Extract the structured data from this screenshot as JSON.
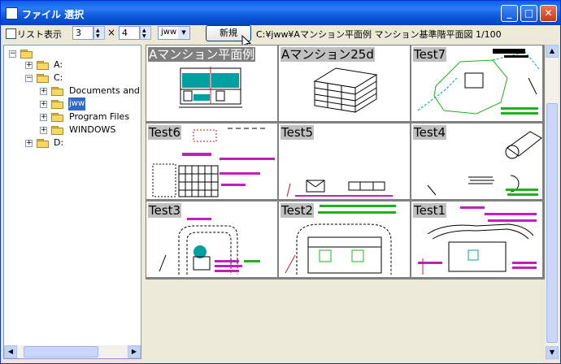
{
  "window": {
    "title": "ファイル 選択"
  },
  "title_buttons": {
    "minimize": "_",
    "maximize": "□",
    "close": "✕"
  },
  "toolbar": {
    "list_label": "リスト表示",
    "cols_value": "3",
    "times": "×",
    "rows_value": "4",
    "ext_value": "jww",
    "new_label": "新規",
    "path": "C:¥jww¥Aマンション平面例 マンション基準階平面図 1/100"
  },
  "tree": {
    "root": "",
    "items": [
      {
        "label": "A:"
      },
      {
        "label": "C:"
      },
      {
        "label": "Documents and S"
      },
      {
        "label": "jww"
      },
      {
        "label": "Program Files"
      },
      {
        "label": "WINDOWS"
      },
      {
        "label": "D:"
      }
    ]
  },
  "thumbnails": [
    {
      "title": "Aマンション平面例"
    },
    {
      "title": "Aマンション25d"
    },
    {
      "title": "Test7"
    },
    {
      "title": "Test6"
    },
    {
      "title": "Test5"
    },
    {
      "title": "Test4"
    },
    {
      "title": "Test3"
    },
    {
      "title": "Test2"
    },
    {
      "title": "Test1"
    }
  ],
  "scroll": {
    "left": "◀",
    "right": "▶",
    "up": "▲",
    "down": "▼"
  },
  "colors": {
    "accent": "#316ac5",
    "cad_cyan": "#00a0a0",
    "cad_magenta": "#c020c0",
    "cad_green": "#20b020"
  }
}
